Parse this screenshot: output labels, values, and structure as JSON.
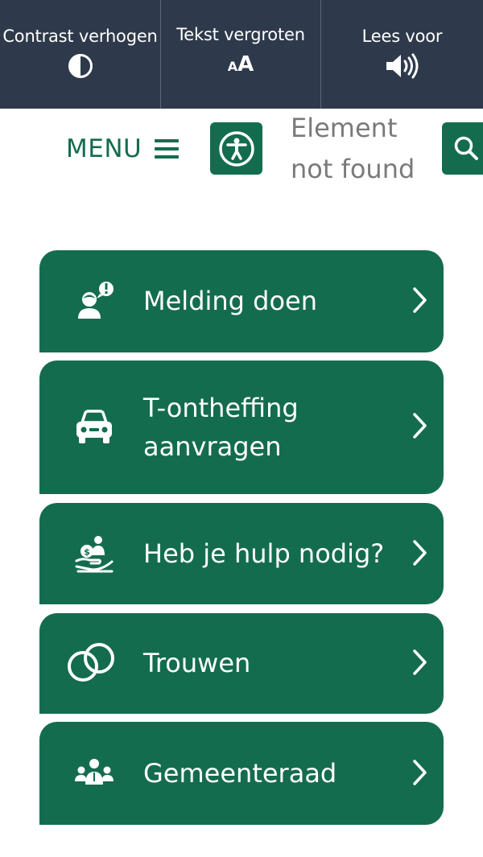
{
  "a11y_bar": {
    "contrast_label": "Contrast verhogen",
    "text_size_label": "Tekst vergroten",
    "text_size_glyph_small": "A",
    "text_size_glyph_big": "A",
    "read_aloud_label": "Lees voor"
  },
  "header": {
    "menu_label": "MENU",
    "not_found_text": "Element not found"
  },
  "tiles": [
    {
      "label": "Melding doen",
      "icon": "report-person-icon"
    },
    {
      "label": "T-ontheffing aanvragen",
      "icon": "car-icon"
    },
    {
      "label": "Heb je hulp nodig?",
      "icon": "helping-hand-icon"
    },
    {
      "label": "Trouwen",
      "icon": "rings-icon"
    },
    {
      "label": "Gemeenteraad",
      "icon": "council-icon"
    }
  ],
  "colors": {
    "brand_green": "#146c4e",
    "top_bar": "#2e3a4b",
    "muted_text": "#7a7a7a"
  }
}
